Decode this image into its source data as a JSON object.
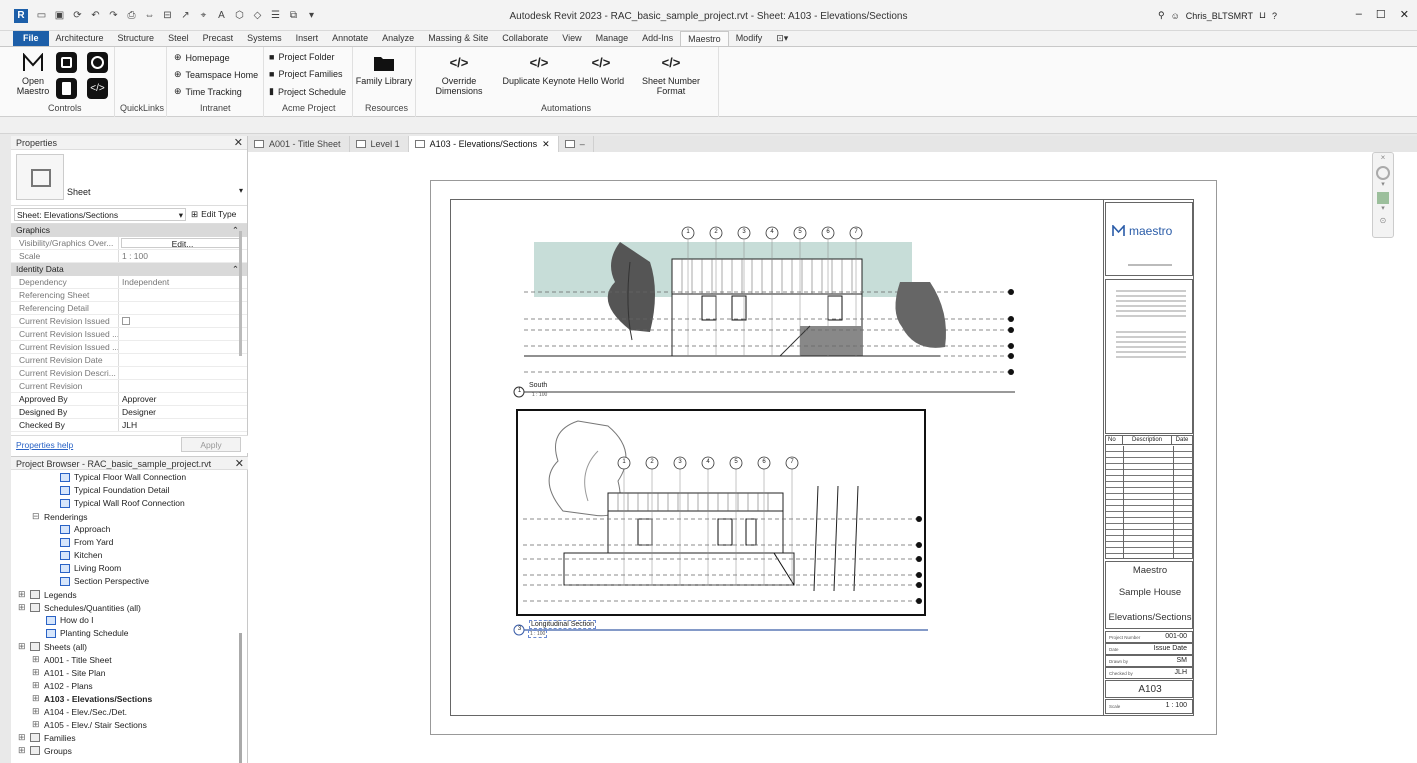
{
  "window": {
    "title": "Autodesk Revit 2023 - RAC_basic_sample_project.rvt - Sheet: A103 - Elevations/Sections",
    "user": "Chris_BLTSMRT",
    "app_letter": "R"
  },
  "ribbon_tabs": [
    "File",
    "Architecture",
    "Structure",
    "Steel",
    "Precast",
    "Systems",
    "Insert",
    "Annotate",
    "Analyze",
    "Massing & Site",
    "Collaborate",
    "View",
    "Manage",
    "Add-Ins",
    "Maestro",
    "Modify"
  ],
  "ribbon": {
    "controls": {
      "open_label": "Open Maestro",
      "panel": "Controls"
    },
    "quicklinks": {
      "panel": "QuickLinks"
    },
    "intranet": {
      "panel": "Intranet",
      "items": [
        "Homepage",
        "Teamspace Home",
        "Time Tracking"
      ]
    },
    "acme": {
      "panel": "Acme Project",
      "items": [
        "Project Folder",
        "Project Families",
        "Project Schedule"
      ]
    },
    "resources": {
      "panel": "Resources",
      "family_library": "Family Library"
    },
    "automations": {
      "panel": "Automations",
      "items": [
        "Override Dimensions",
        "Duplicate Keynote",
        "Hello World",
        "Sheet Number Format"
      ]
    }
  },
  "properties": {
    "title": "Properties",
    "type_name": "Sheet",
    "selector": "Sheet: Elevations/Sections",
    "edit_type": "Edit Type",
    "graphics_header": "Graphics",
    "identity_header": "Identity Data",
    "rows_graphics": [
      {
        "k": "Visibility/Graphics Over...",
        "v": "Edit..."
      },
      {
        "k": "Scale",
        "v": "1 : 100"
      }
    ],
    "rows_identity": [
      {
        "k": "Dependency",
        "v": "Independent"
      },
      {
        "k": "Referencing Sheet",
        "v": ""
      },
      {
        "k": "Referencing Detail",
        "v": ""
      },
      {
        "k": "Current Revision Issued",
        "v": ""
      },
      {
        "k": "Current Revision Issued ...",
        "v": ""
      },
      {
        "k": "Current Revision Issued ...",
        "v": ""
      },
      {
        "k": "Current Revision Date",
        "v": ""
      },
      {
        "k": "Current Revision Descri...",
        "v": ""
      },
      {
        "k": "Current Revision",
        "v": ""
      },
      {
        "k": "Approved By",
        "v": "Approver"
      },
      {
        "k": "Designed By",
        "v": "Designer"
      },
      {
        "k": "Checked By",
        "v": "JLH"
      }
    ],
    "help": "Properties help",
    "apply": "Apply"
  },
  "browser": {
    "title": "Project Browser - RAC_basic_sample_project.rvt",
    "items": [
      {
        "t": "Typical Floor Wall Connection",
        "lvl": 3,
        "icon": "view"
      },
      {
        "t": "Typical Foundation Detail",
        "lvl": 3,
        "icon": "view"
      },
      {
        "t": "Typical Wall Roof Connection",
        "lvl": 3,
        "icon": "view"
      },
      {
        "t": "Renderings",
        "lvl": 1,
        "icon": "minus"
      },
      {
        "t": "Approach",
        "lvl": 3,
        "icon": "view"
      },
      {
        "t": "From Yard",
        "lvl": 3,
        "icon": "view"
      },
      {
        "t": "Kitchen",
        "lvl": 3,
        "icon": "view"
      },
      {
        "t": "Living Room",
        "lvl": 3,
        "icon": "view"
      },
      {
        "t": "Section Perspective",
        "lvl": 3,
        "icon": "view"
      },
      {
        "t": "Legends",
        "lvl": 0,
        "icon": "legend"
      },
      {
        "t": "Schedules/Quantities (all)",
        "lvl": 0,
        "icon": "sched"
      },
      {
        "t": "How do I",
        "lvl": 2,
        "icon": "view"
      },
      {
        "t": "Planting Schedule",
        "lvl": 2,
        "icon": "view"
      },
      {
        "t": "Sheets (all)",
        "lvl": 0,
        "icon": "sheets"
      },
      {
        "t": "A001 - Title Sheet",
        "lvl": 1,
        "icon": "plus"
      },
      {
        "t": "A101 - Site Plan",
        "lvl": 1,
        "icon": "plus"
      },
      {
        "t": "A102 - Plans",
        "lvl": 1,
        "icon": "plus"
      },
      {
        "t": "A103 - Elevations/Sections",
        "lvl": 1,
        "icon": "plus",
        "bold": true
      },
      {
        "t": "A104 - Elev./Sec./Det.",
        "lvl": 1,
        "icon": "plus"
      },
      {
        "t": "A105 - Elev./ Stair Sections",
        "lvl": 1,
        "icon": "plus"
      },
      {
        "t": "Families",
        "lvl": 0,
        "icon": "fam"
      },
      {
        "t": "Groups",
        "lvl": 0,
        "icon": "grp"
      }
    ]
  },
  "view_tabs": [
    "A001 - Title Sheet",
    "Level 1",
    "A103 - Elevations/Sections"
  ],
  "sheet": {
    "logo": "maestro",
    "south_title": "South",
    "south_number": "1",
    "south_scale": "1 : 100",
    "section_title": "Longitudinal Section",
    "section_number": "3",
    "section_scale": "1 : 100",
    "grid_labels": [
      "1",
      "2",
      "3",
      "4",
      "5",
      "6",
      "7"
    ],
    "rev_headers": [
      "No",
      "Description",
      "Date"
    ],
    "client": "Maestro",
    "project": "Sample House",
    "sheet_name": "Elevations/Sections",
    "rows": [
      {
        "k": "Project Number",
        "v": "001-00"
      },
      {
        "k": "Date",
        "v": "Issue Date"
      },
      {
        "k": "Drawn by",
        "v": "SM"
      },
      {
        "k": "Checked by",
        "v": "JLH"
      }
    ],
    "sheet_number": "A103",
    "scale_label": "Scale",
    "scale": "1 : 100"
  }
}
